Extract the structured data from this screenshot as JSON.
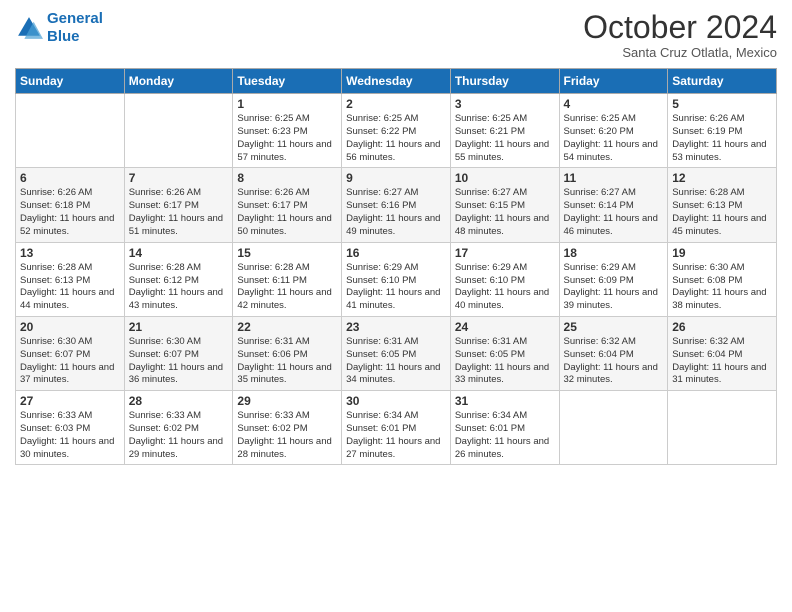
{
  "header": {
    "logo_line1": "General",
    "logo_line2": "Blue",
    "month": "October 2024",
    "location": "Santa Cruz Otlatla, Mexico"
  },
  "weekdays": [
    "Sunday",
    "Monday",
    "Tuesday",
    "Wednesday",
    "Thursday",
    "Friday",
    "Saturday"
  ],
  "weeks": [
    [
      {
        "day": "",
        "text": ""
      },
      {
        "day": "",
        "text": ""
      },
      {
        "day": "1",
        "text": "Sunrise: 6:25 AM\nSunset: 6:23 PM\nDaylight: 11 hours and 57 minutes."
      },
      {
        "day": "2",
        "text": "Sunrise: 6:25 AM\nSunset: 6:22 PM\nDaylight: 11 hours and 56 minutes."
      },
      {
        "day": "3",
        "text": "Sunrise: 6:25 AM\nSunset: 6:21 PM\nDaylight: 11 hours and 55 minutes."
      },
      {
        "day": "4",
        "text": "Sunrise: 6:25 AM\nSunset: 6:20 PM\nDaylight: 11 hours and 54 minutes."
      },
      {
        "day": "5",
        "text": "Sunrise: 6:26 AM\nSunset: 6:19 PM\nDaylight: 11 hours and 53 minutes."
      }
    ],
    [
      {
        "day": "6",
        "text": "Sunrise: 6:26 AM\nSunset: 6:18 PM\nDaylight: 11 hours and 52 minutes."
      },
      {
        "day": "7",
        "text": "Sunrise: 6:26 AM\nSunset: 6:17 PM\nDaylight: 11 hours and 51 minutes."
      },
      {
        "day": "8",
        "text": "Sunrise: 6:26 AM\nSunset: 6:17 PM\nDaylight: 11 hours and 50 minutes."
      },
      {
        "day": "9",
        "text": "Sunrise: 6:27 AM\nSunset: 6:16 PM\nDaylight: 11 hours and 49 minutes."
      },
      {
        "day": "10",
        "text": "Sunrise: 6:27 AM\nSunset: 6:15 PM\nDaylight: 11 hours and 48 minutes."
      },
      {
        "day": "11",
        "text": "Sunrise: 6:27 AM\nSunset: 6:14 PM\nDaylight: 11 hours and 46 minutes."
      },
      {
        "day": "12",
        "text": "Sunrise: 6:28 AM\nSunset: 6:13 PM\nDaylight: 11 hours and 45 minutes."
      }
    ],
    [
      {
        "day": "13",
        "text": "Sunrise: 6:28 AM\nSunset: 6:13 PM\nDaylight: 11 hours and 44 minutes."
      },
      {
        "day": "14",
        "text": "Sunrise: 6:28 AM\nSunset: 6:12 PM\nDaylight: 11 hours and 43 minutes."
      },
      {
        "day": "15",
        "text": "Sunrise: 6:28 AM\nSunset: 6:11 PM\nDaylight: 11 hours and 42 minutes."
      },
      {
        "day": "16",
        "text": "Sunrise: 6:29 AM\nSunset: 6:10 PM\nDaylight: 11 hours and 41 minutes."
      },
      {
        "day": "17",
        "text": "Sunrise: 6:29 AM\nSunset: 6:10 PM\nDaylight: 11 hours and 40 minutes."
      },
      {
        "day": "18",
        "text": "Sunrise: 6:29 AM\nSunset: 6:09 PM\nDaylight: 11 hours and 39 minutes."
      },
      {
        "day": "19",
        "text": "Sunrise: 6:30 AM\nSunset: 6:08 PM\nDaylight: 11 hours and 38 minutes."
      }
    ],
    [
      {
        "day": "20",
        "text": "Sunrise: 6:30 AM\nSunset: 6:07 PM\nDaylight: 11 hours and 37 minutes."
      },
      {
        "day": "21",
        "text": "Sunrise: 6:30 AM\nSunset: 6:07 PM\nDaylight: 11 hours and 36 minutes."
      },
      {
        "day": "22",
        "text": "Sunrise: 6:31 AM\nSunset: 6:06 PM\nDaylight: 11 hours and 35 minutes."
      },
      {
        "day": "23",
        "text": "Sunrise: 6:31 AM\nSunset: 6:05 PM\nDaylight: 11 hours and 34 minutes."
      },
      {
        "day": "24",
        "text": "Sunrise: 6:31 AM\nSunset: 6:05 PM\nDaylight: 11 hours and 33 minutes."
      },
      {
        "day": "25",
        "text": "Sunrise: 6:32 AM\nSunset: 6:04 PM\nDaylight: 11 hours and 32 minutes."
      },
      {
        "day": "26",
        "text": "Sunrise: 6:32 AM\nSunset: 6:04 PM\nDaylight: 11 hours and 31 minutes."
      }
    ],
    [
      {
        "day": "27",
        "text": "Sunrise: 6:33 AM\nSunset: 6:03 PM\nDaylight: 11 hours and 30 minutes."
      },
      {
        "day": "28",
        "text": "Sunrise: 6:33 AM\nSunset: 6:02 PM\nDaylight: 11 hours and 29 minutes."
      },
      {
        "day": "29",
        "text": "Sunrise: 6:33 AM\nSunset: 6:02 PM\nDaylight: 11 hours and 28 minutes."
      },
      {
        "day": "30",
        "text": "Sunrise: 6:34 AM\nSunset: 6:01 PM\nDaylight: 11 hours and 27 minutes."
      },
      {
        "day": "31",
        "text": "Sunrise: 6:34 AM\nSunset: 6:01 PM\nDaylight: 11 hours and 26 minutes."
      },
      {
        "day": "",
        "text": ""
      },
      {
        "day": "",
        "text": ""
      }
    ]
  ]
}
